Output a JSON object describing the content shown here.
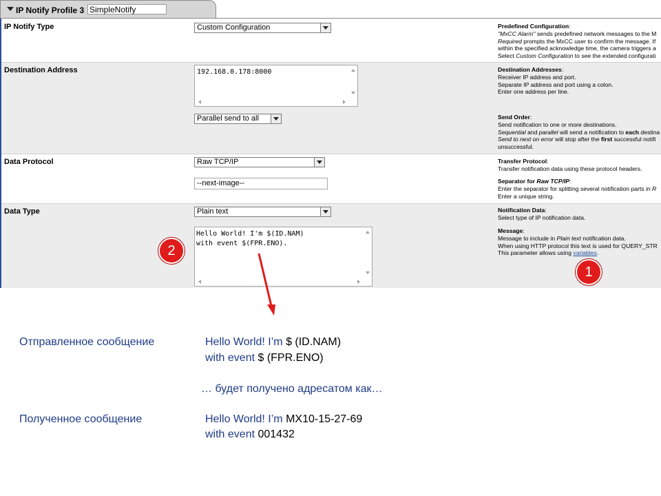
{
  "tab": {
    "title": "IP Notify Profile 3",
    "profile_name": "SimpleNotify"
  },
  "rows": {
    "notify_type": {
      "label": "IP Notify Type",
      "select_value": "Custom Configuration",
      "help": {
        "heading": "Predefined Configuration",
        "line1a": "\"MxCC Alarm\"",
        "line1b": " sends predefined network messages to the M",
        "line2a": "Required",
        "line2b": " prompts the MxCC user to confirm the message. If",
        "line3": "within the specified acknowledge time, the camera triggers a",
        "line4a": "Select ",
        "line4b": "Custom Configuration",
        "line4c": " to see the extended configurati"
      }
    },
    "destination": {
      "label": "Destination Address",
      "textarea_value": "192.168.0.178:8000",
      "send_order_value": "Parallel send to all",
      "help1": {
        "heading": "Destination Addresses",
        "line1": "Receiver IP address and port.",
        "line2": "Separate IP address and port using a colon.",
        "line3": "Enter one address per line."
      },
      "help2": {
        "heading": "Send Order",
        "line1": "Send notification to one or more destinations.",
        "line2a": "Sequential",
        "line2b": " and ",
        "line2c": "parallel",
        "line2d": " will send a notification to ",
        "line2e": "each",
        "line2f": " destina",
        "line3a": "Send to next on error",
        "line3b": " will stop after the ",
        "line3c": "first",
        "line3d": " successful notifi",
        "line4": "unsuccessful."
      }
    },
    "protocol": {
      "label": "Data Protocol",
      "select_value": "Raw TCP/IP",
      "separator_value": "--next-image--",
      "help1": {
        "heading": "Transfer Protocol",
        "line1": "Transfer notification data using these protocol headers."
      },
      "help2": {
        "heading_a": "Separator for ",
        "heading_b": "Raw TCP/IP",
        "line1a": "Enter the separator for splitting several notification parts in ",
        "line1b": "R",
        "line2": "Enter a unique string."
      }
    },
    "data_type": {
      "label": "Data Type",
      "select_value": "Plain text",
      "message_line1": "Hello World! I'm $(ID.NAM)",
      "message_line2": "with event $(FPR.ENO).",
      "help1": {
        "heading": "Notification Data",
        "line1": "Select type of IP notification data."
      },
      "help2": {
        "heading": "Message",
        "line1a": "Message to include in ",
        "line1b": "Plain text",
        "line1c": " notification data.",
        "line2": "When using HTTP protocol this text is used for QUERY_STR",
        "line3a": "This parameter allows using ",
        "line3b": "variables",
        "line3c": "."
      }
    }
  },
  "markers": {
    "one": "1",
    "two": "2"
  },
  "lower": {
    "sent_label": "Отправленное сообщение",
    "sent_line1_text": "Hello World! I’m ",
    "sent_line1_var": "$ (ID.NAM)",
    "sent_line2_text": "with event ",
    "sent_line2_var": "$ (FPR.ENO)",
    "middle": "… будет получено адресатом как…",
    "received_label": "Полученное сообщение",
    "recv_line1_text": "Hello World! I’m ",
    "recv_line1_var": "MX10-15-27-69",
    "recv_line2_text": "with event ",
    "recv_line2_var": "001432"
  },
  "colors": {
    "accent": "#2a4e9c",
    "marker": "#e01b1b",
    "arrow": "#e01b1b",
    "russian_text": "#1f3b88"
  }
}
